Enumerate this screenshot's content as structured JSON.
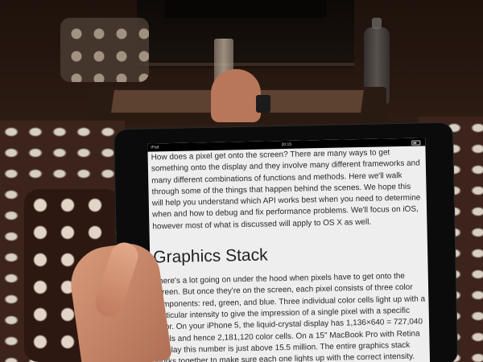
{
  "status_bar": {
    "device": "iPad",
    "time": "20:15"
  },
  "article": {
    "intro": "How does a pixel get onto the screen? There are many ways to get something onto the display and they involve many different frameworks and many different combinations of functions and methods. Here we'll walk through some of the things that happen behind the scenes. We hope this will help you understand which API works best when you need to determine when and how to debug and fix performance problems. We'll focus on iOS, however most of what is discussed will apply to OS X as well.",
    "section_heading": "Graphics Stack",
    "body": "There's a lot going on under the hood when pixels have to get onto the screen. But once they're on the screen, each pixel consists of three color components: red, green, and blue. Three individual color cells light up with a particular intensity to give the impression of a single pixel with a specific color. On your iPhone 5, the liquid-crystal display has 1,136×640 = 727,040 pixels and hence 2,181,120 color cells. On a 15\" MacBook Pro with Retina Display this number is just above 15.5 million. The entire graphics stack works together to make sure each one lights up with the correct intensity. And when you scroll in full screen, all those million intensities have to"
  }
}
